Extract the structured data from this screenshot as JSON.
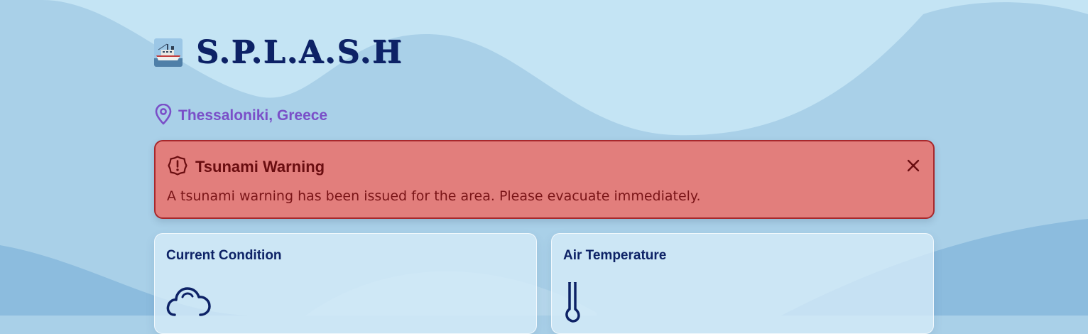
{
  "app": {
    "title": "S.P.L.A.S.H",
    "logo_icon": "ship-logo-icon"
  },
  "location": {
    "icon": "map-pin-icon",
    "label": "Thessaloniki, Greece"
  },
  "alert": {
    "icon": "alert-circle-icon",
    "title": "Tsunami Warning",
    "message": "A tsunami warning has been issued for the area. Please evacuate immediately.",
    "close_icon": "close-icon"
  },
  "cards": [
    {
      "title": "Current Condition",
      "icon": "cloud-icon"
    },
    {
      "title": "Air Temperature",
      "icon": "thermometer-icon"
    }
  ],
  "colors": {
    "background": "#a9d0e8",
    "wave_light": "#c4e4f4",
    "wave_deep": "#8cbcde",
    "title": "#0d2266",
    "location": "#7a4fc8",
    "alert_background": "#e27e7c",
    "alert_border": "#a8282c",
    "alert_text": "#6a0d10"
  }
}
